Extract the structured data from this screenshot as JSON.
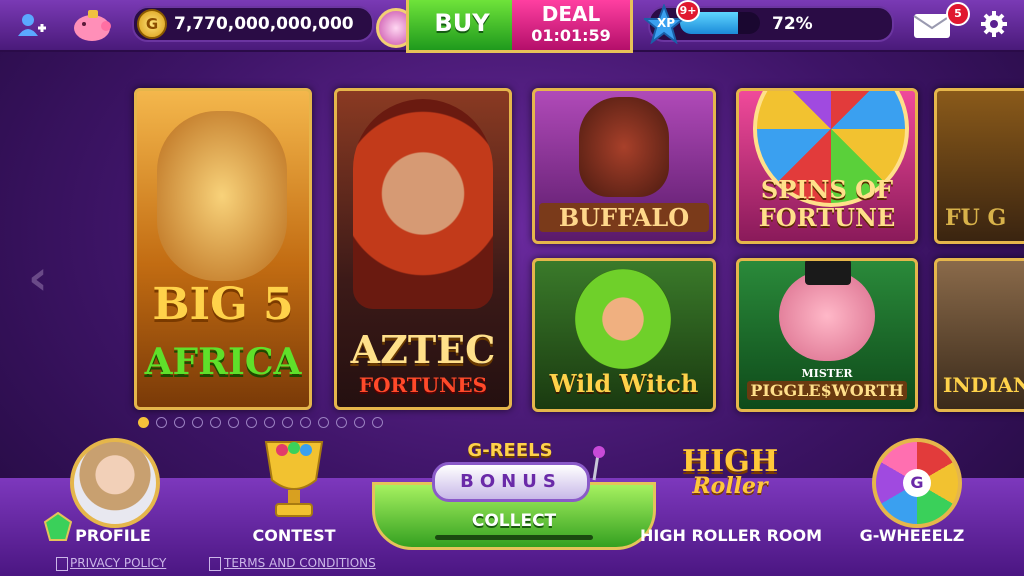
{
  "topbar": {
    "coin_symbol": "G",
    "coins": "7,770,000,000,000",
    "buy_label": "BUY",
    "deal_label": "DEAL",
    "deal_timer": "01:01:59",
    "xp_label": "XP",
    "level_badge": "9+",
    "xp_progress": 0.72,
    "xp_percent": "72%",
    "mail_badge": "5"
  },
  "games": [
    {
      "line1": "BIG 5",
      "line2": "AFRICA"
    },
    {
      "line1": "AZTEC",
      "line2": "FORTUNES"
    },
    {
      "line1": "BUFFALO"
    },
    {
      "line1": "SPINS OF",
      "line2": "FORTUNE"
    },
    {
      "line1": "FU G"
    },
    {
      "line1": "Wild Witch"
    },
    {
      "line1": "MISTER",
      "line2": "PIGGLE$WORTH"
    },
    {
      "line1": "INDIANA"
    }
  ],
  "carousel": {
    "page_count": 14,
    "active_index": 0
  },
  "nav": {
    "profile": "PROFILE",
    "contest": "CONTEST",
    "greels": "G-REELS",
    "bonus": "BONUS",
    "collect": "COLLECT",
    "high_roller_logo1": "HIGH",
    "high_roller_logo2": "Roller",
    "high_roller": "HIGH ROLLER ROOM",
    "wheel_letter": "G",
    "gwheelz": "G-WHEEELZ"
  },
  "footer": {
    "privacy": "PRIVACY POLICY",
    "terms": "TERMS AND CONDITIONS"
  },
  "colors": {
    "gold": "#e5b64b",
    "buy_green": "#2fae22",
    "deal_pink": "#e0207f",
    "xp_blue": "#2a9ae6"
  }
}
